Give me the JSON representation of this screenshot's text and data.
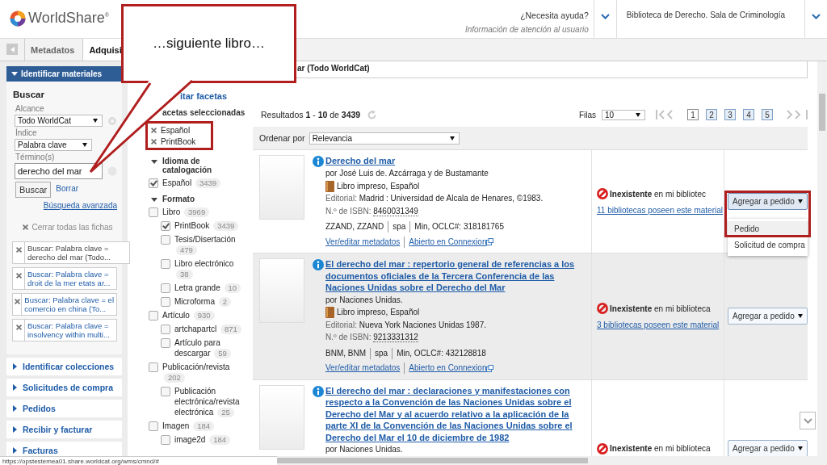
{
  "header": {
    "logo": "WorldShare$^{®}$",
    "help": "¿Necesita ayuda?",
    "help_sub": "Información de atención al usuario",
    "library": "Biblioteca de Derecho. Sala de Criminología"
  },
  "tabs": [
    {
      "label": "Metadatos",
      "selected": false
    },
    {
      "label": "Adquisi",
      "selected": true
    }
  ],
  "callout": {
    "text": "…siguiente libro…"
  },
  "sidebar": {
    "panel_title": "Identificar materiales",
    "search_heading": "Buscar",
    "scope_label": "Alcance",
    "scope": "Todo WorldCat",
    "index_label": "Índice",
    "index": "Palabra clave",
    "term_label": "Término(s)",
    "term": "derecho del mar",
    "search_button": "Buscar",
    "clear_button": "Borrar",
    "advanced": "Búsqueda avanzada",
    "close_all": "Cerrar todas las fichas",
    "recent": [
      {
        "lines": [
          "Buscar: Palabra clave =",
          "derecho del mar (Todo..."
        ],
        "selected": true
      },
      {
        "lines": [
          "Buscar: Palabra clave =",
          "droit de la mer etats ar..."
        ],
        "selected": false
      },
      {
        "lines": [
          "Buscar: Palabra clave = el",
          "comercio en china (To..."
        ],
        "selected": false
      },
      {
        "lines": [
          "Buscar: Palabra clave =",
          "insolvency within multi..."
        ],
        "selected": false
      }
    ],
    "sections": [
      "Identificar colecciones",
      "Solicitudes de compra",
      "Pedidos",
      "Recibir y facturar",
      "Facturas"
    ]
  },
  "search_title": "ar (Todo WorldCat)",
  "facets": {
    "edit": "itar facetas",
    "selected_title": "acetas seleccionadas",
    "selected": [
      "Español",
      "PrintBook"
    ],
    "groups": [
      {
        "title": "Idioma de catalogación",
        "expanded": true,
        "items": [
          {
            "label": "Español",
            "count": "3439",
            "checked": true
          }
        ]
      },
      {
        "title": "Formato",
        "expanded": true,
        "items": [
          {
            "label": "Libro",
            "count": "3969",
            "checked": false,
            "children": [
              {
                "label": "PrintBook",
                "count": "3439",
                "checked": true
              },
              {
                "label": "Tesis/Disertación",
                "count": "479",
                "checked": false
              },
              {
                "label": "Libro electrónico",
                "count": "38",
                "checked": false
              },
              {
                "label": "Letra grande",
                "count": "10",
                "checked": false
              },
              {
                "label": "Microforma",
                "count": "2",
                "checked": false
              }
            ]
          },
          {
            "label": "Artículo",
            "count": "930",
            "checked": false,
            "children": [
              {
                "label": "artchapartcl",
                "count": "871",
                "checked": false
              },
              {
                "label": "Artículo para descargar",
                "count": "59",
                "checked": false
              }
            ]
          },
          {
            "label": "Publicación/revista",
            "count": "202",
            "checked": false,
            "children": [
              {
                "label": "Publicación electrónica/revista electrónica",
                "count": "25",
                "checked": false
              }
            ]
          },
          {
            "label": "Imagen",
            "count": "184",
            "checked": false,
            "children": [
              {
                "label": "image2d",
                "count": "184",
                "checked": false
              }
            ]
          }
        ]
      }
    ]
  },
  "results": {
    "summary": "Resultados **1** - **10** de **3439**",
    "rows_label": "Filas",
    "rows": "10",
    "pages": [
      {
        "label": "1",
        "selected": true
      },
      {
        "label": "2",
        "selected": false
      },
      {
        "label": "3",
        "selected": false
      },
      {
        "label": "4",
        "selected": false
      },
      {
        "label": "5",
        "selected": false
      }
    ],
    "sort_label": "Ordenar por",
    "sort": "Relevancia",
    "items": [
      {
        "title": "Derecho del mar",
        "author": "por José Luis de. Azcárraga y de Bustamante",
        "format": "Libro impreso, Español",
        "publisher_label": "Editorial:",
        "publisher": "Madrid : Universidad de Alcala de Henares, ©1983.",
        "isbn_label": "N.º de ISBN:",
        "isbn": "8460031349",
        "codes": [
          "ZZAND, ZZAND",
          "spa",
          "Min, OCLC#: 318181765"
        ],
        "links": [
          "Ver/editar metadatos",
          "Abierto en Connexion"
        ],
        "status": "**Inexistente** en mi bibliotec",
        "holdings": "11 bibliotecas poseen este material",
        "action": "Agregar a pedido",
        "highlighted": false,
        "menu_open": true,
        "menu": [
          {
            "label": "Pedido",
            "selected": true
          },
          {
            "label": "Solicitud de compra",
            "selected": false
          }
        ]
      },
      {
        "title": "El derecho del mar : repertorio general de referencias a los documentos oficiales de la Tercera Conferencia de las Naciones Unidas sobre el Derecho del Mar",
        "author": "por Naciones Unidas.",
        "format": "Libro impreso, Español",
        "publisher_label": "Editorial:",
        "publisher": "Nueva York Naciones Unidas 1987.",
        "isbn_label": "N.º de ISBN:",
        "isbn": "9213331312",
        "codes": [
          "BNM, BNM",
          "spa",
          "Min, OCLC#: 432128818"
        ],
        "links": [
          "Ver/editar metadatos",
          "Abierto en Connexion"
        ],
        "status": "**Inexistente** en mi biblioteca",
        "holdings": "3 bibliotecas poseen este material",
        "action": "Agregar a pedido",
        "highlighted": true,
        "menu_open": false
      },
      {
        "title": "El derecho del mar : declaraciones y manifestaciones con respecto a la Convención de las Naciones Unidas sobre el Derecho del Mar y al acuerdo relativo a la aplicación de la parte XI de la Convención de las Naciones Unidas sobre el Derecho del Mar el 10 de diciembre de 1982",
        "author": "por Naciones Unidas.",
        "status": "**Inexistente** en mi biblioteca",
        "action": "Agregar a pedido",
        "highlighted": false,
        "menu_open": false
      }
    ]
  },
  "status_bar": {
    "url": "https://opstestemea01.share.worldcat.org/wms/cmnd/#"
  }
}
